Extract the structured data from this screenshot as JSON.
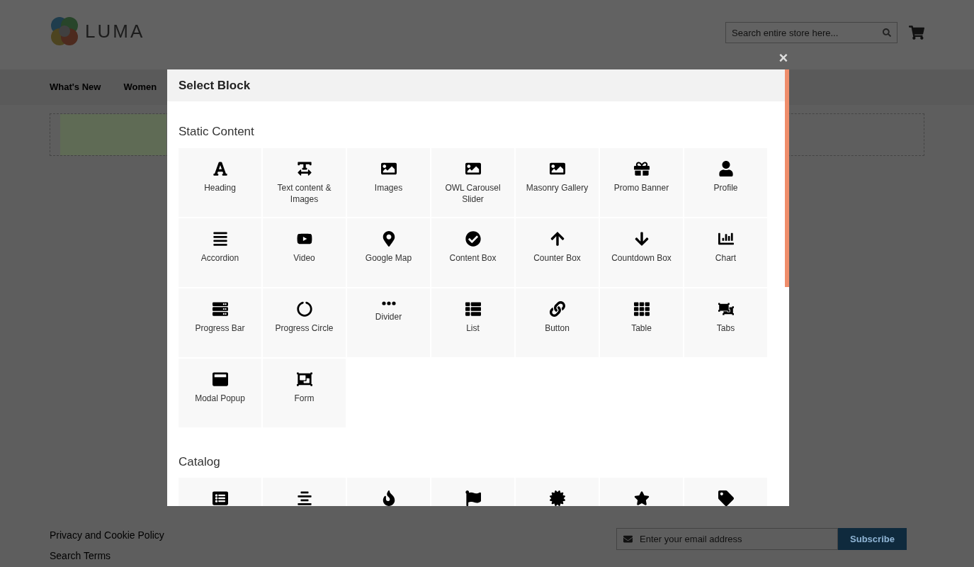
{
  "header": {
    "logo_text": "LUMA",
    "search": {
      "placeholder": "Search entire store here..."
    }
  },
  "nav": [
    {
      "label": "What's New"
    },
    {
      "label": "Women"
    }
  ],
  "modal": {
    "title": "Select Block",
    "close": "×",
    "sections": [
      {
        "title": "Static Content",
        "blocks": [
          {
            "kind": "heading",
            "label": "Heading"
          },
          {
            "kind": "text",
            "label": "Text content & Images"
          },
          {
            "kind": "image",
            "label": "Images"
          },
          {
            "kind": "image",
            "label": "OWL Carousel Slider"
          },
          {
            "kind": "image",
            "label": "Masonry Gallery"
          },
          {
            "kind": "gift",
            "label": "Promo Banner"
          },
          {
            "kind": "user",
            "label": "Profile"
          },
          {
            "kind": "lines",
            "label": "Accordion"
          },
          {
            "kind": "video",
            "label": "Video"
          },
          {
            "kind": "marker",
            "label": "Google Map"
          },
          {
            "kind": "check",
            "label": "Content Box"
          },
          {
            "kind": "up",
            "label": "Counter Box"
          },
          {
            "kind": "down",
            "label": "Countdown Box"
          },
          {
            "kind": "chart",
            "label": "Chart"
          },
          {
            "kind": "server",
            "label": "Progress Bar"
          },
          {
            "kind": "ring",
            "label": "Progress Circle"
          },
          {
            "kind": "dots",
            "label": "Divider"
          },
          {
            "kind": "list",
            "label": "List"
          },
          {
            "kind": "link",
            "label": "Button"
          },
          {
            "kind": "grid",
            "label": "Table"
          },
          {
            "kind": "ungroup",
            "label": "Tabs"
          },
          {
            "kind": "window",
            "label": "Modal Popup"
          },
          {
            "kind": "group",
            "label": "Form"
          }
        ]
      },
      {
        "title": "Catalog",
        "blocks": [
          {
            "kind": "listalt"
          },
          {
            "kind": "center"
          },
          {
            "kind": "fire"
          },
          {
            "kind": "flag"
          },
          {
            "kind": "badge"
          },
          {
            "kind": "star"
          },
          {
            "kind": "tag"
          }
        ]
      }
    ]
  },
  "footer": {
    "links": [
      "Privacy and Cookie Policy",
      "Search Terms"
    ],
    "newsletter": {
      "placeholder": "Enter your email address",
      "button": "Subscribe"
    }
  }
}
